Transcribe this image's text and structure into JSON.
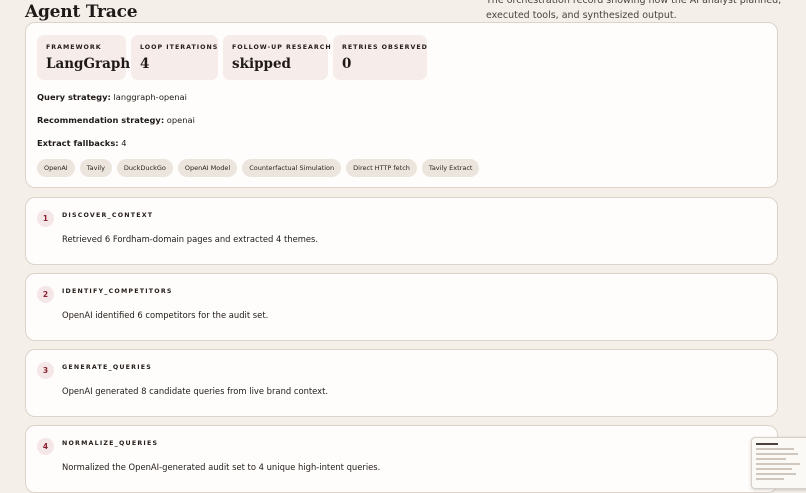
{
  "page": {
    "title": "Agent Trace",
    "subtitle": "The orchestration record showing how the AI analyst planned, executed tools, and synthesized output."
  },
  "summary": {
    "metrics": [
      {
        "label": "FRAMEWORK",
        "value": "LangGraph"
      },
      {
        "label": "LOOP ITERATIONS",
        "value": "4"
      },
      {
        "label": "FOLLOW-UP RESEARCH",
        "value": "skipped"
      },
      {
        "label": "RETRIES OBSERVED",
        "value": "0"
      }
    ],
    "query_strategy": {
      "label": "Query strategy:",
      "value": "langgraph-openai"
    },
    "recommendation_strategy": {
      "label": "Recommendation strategy:",
      "value": "openai"
    },
    "extract_fallbacks": {
      "label": "Extract fallbacks:",
      "value": "4"
    },
    "tools": [
      "OpenAI",
      "Tavily",
      "DuckDuckGo",
      "OpenAI Model",
      "Counterfactual Simulation",
      "Direct HTTP fetch",
      "Tavily Extract"
    ]
  },
  "steps": [
    {
      "number": "1",
      "name": "DISCOVER_CONTEXT",
      "description": "Retrieved 6 Fordham-domain pages and extracted 4 themes."
    },
    {
      "number": "2",
      "name": "IDENTIFY_COMPETITORS",
      "description": "OpenAI identified 6 competitors for the audit set."
    },
    {
      "number": "3",
      "name": "GENERATE_QUERIES",
      "description": "OpenAI generated 8 candidate queries from live brand context."
    },
    {
      "number": "4",
      "name": "NORMALIZE_QUERIES",
      "description": "Normalized the OpenAI-generated audit set to 4 unique high-intent queries."
    }
  ],
  "colors": {
    "background": "#f4efe9",
    "card": "#fffdfb",
    "metric_tile": "#f6ecea",
    "chip": "#ece5dd",
    "step_number": "#8a2430"
  }
}
